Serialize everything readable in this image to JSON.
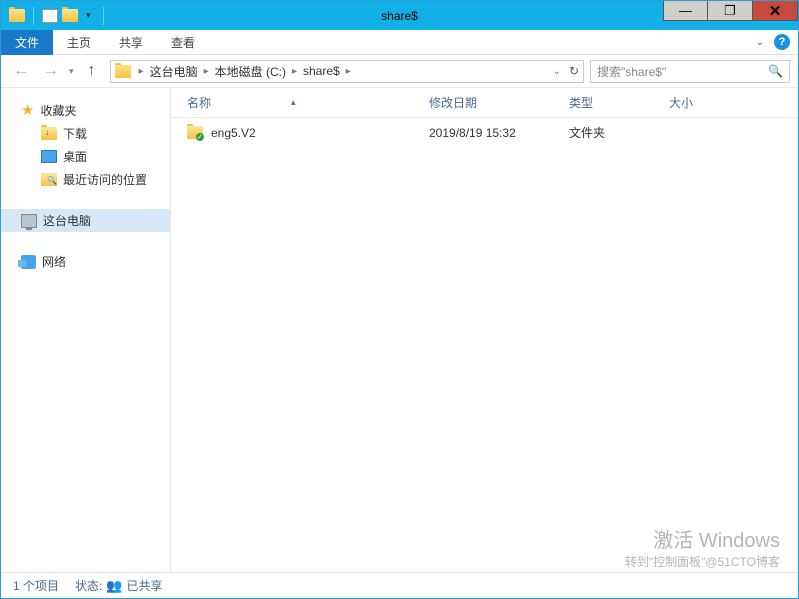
{
  "window": {
    "title": "share$"
  },
  "ribbon": {
    "file": "文件",
    "home": "主页",
    "share": "共享",
    "view": "查看"
  },
  "breadcrumb": {
    "seg1": "这台电脑",
    "seg2": "本地磁盘 (C:)",
    "seg3": "share$"
  },
  "search": {
    "placeholder": "搜索\"share$\""
  },
  "sidebar": {
    "favorites": "收藏夹",
    "downloads": "下载",
    "desktop": "桌面",
    "recent": "最近访问的位置",
    "this_pc": "这台电脑",
    "network": "网络"
  },
  "columns": {
    "name": "名称",
    "date": "修改日期",
    "type": "类型",
    "size": "大小"
  },
  "files": [
    {
      "name": "eng5.V2",
      "date": "2019/8/19 15:32",
      "type": "文件夹",
      "size": ""
    }
  ],
  "status": {
    "count": "1 个项目",
    "state_label": "状态:",
    "shared": "已共享"
  },
  "watermark": {
    "title": "激活 Windows",
    "sub": "转到\"控制面板\"@51CTO博客"
  }
}
